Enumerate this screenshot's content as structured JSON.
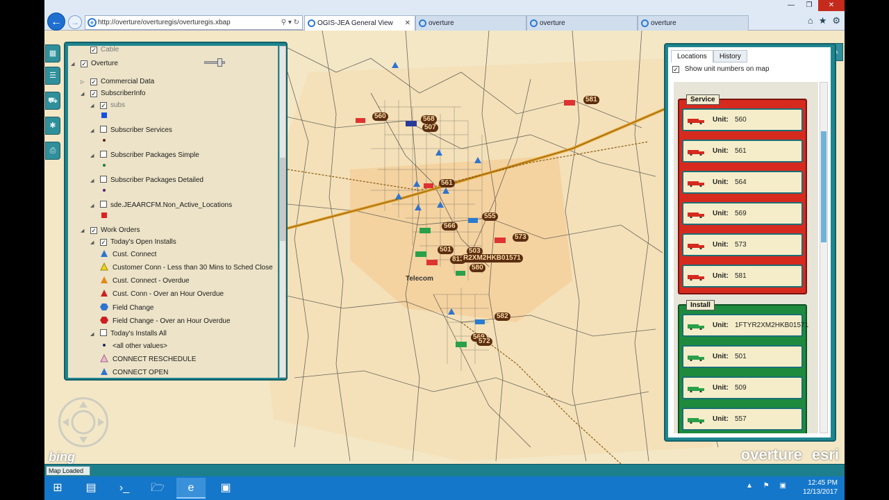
{
  "browser": {
    "address": "http://overture/overturegis/overturegis.xbap",
    "tabs": [
      {
        "label": "OGIS-JEA General View",
        "active": true
      },
      {
        "label": "overture",
        "active": false
      },
      {
        "label": "overture",
        "active": false
      },
      {
        "label": "overture",
        "active": false
      }
    ]
  },
  "layers": {
    "rows": [
      {
        "text": "Cable",
        "level": 1,
        "check": "checked",
        "expand": "",
        "muted": true
      },
      {
        "text": "Overture",
        "level": 0,
        "check": "checked",
        "expand": "open"
      },
      {
        "text": "Commercial Data",
        "level": 1,
        "check": "checked",
        "expand": "closed"
      },
      {
        "text": "SubscriberInfo",
        "level": 1,
        "check": "checked",
        "expand": "open"
      },
      {
        "text": "subs",
        "level": 2,
        "check": "checked",
        "expand": "open",
        "muted": true
      },
      {
        "text": "",
        "level": 3,
        "symbol": "square-blue"
      },
      {
        "text": "Subscriber Services",
        "level": 2,
        "check": "unchecked",
        "expand": "open"
      },
      {
        "text": "",
        "level": 3,
        "symbol": "dot-brown"
      },
      {
        "text": "Subscriber Packages Simple",
        "level": 2,
        "check": "unchecked",
        "expand": "open"
      },
      {
        "text": "",
        "level": 3,
        "symbol": "dot-green"
      },
      {
        "text": "Subscriber Packages Detailed",
        "level": 2,
        "check": "unchecked",
        "expand": "open"
      },
      {
        "text": "",
        "level": 3,
        "symbol": "dot-purple"
      },
      {
        "text": "sde.JEAARCFM.Non_Active_Locations",
        "level": 2,
        "check": "unchecked",
        "expand": "open"
      },
      {
        "text": "",
        "level": 3,
        "symbol": "square-red"
      },
      {
        "text": "Work Orders",
        "level": 1,
        "check": "checked",
        "expand": "open"
      },
      {
        "text": "Today's Open Installs",
        "level": 2,
        "check": "checked",
        "expand": "open"
      },
      {
        "text": "Cust. Connect",
        "level": 3,
        "symbol": "triangle-blue"
      },
      {
        "text": "Customer Conn - Less than 30 Mins to Sched Close",
        "level": 3,
        "symbol": "triangle-yellow"
      },
      {
        "text": "Cust. Connect - Overdue",
        "level": 3,
        "symbol": "triangle-orange"
      },
      {
        "text": "Cust. Conn - Over an Hour Overdue",
        "level": 3,
        "symbol": "triangle-red"
      },
      {
        "text": "Field Change",
        "level": 3,
        "symbol": "hexagon-blue"
      },
      {
        "text": "Field Change - Over an Hour Overdue",
        "level": 3,
        "symbol": "hexagon-red"
      },
      {
        "text": "Today's Installs All",
        "level": 2,
        "check": "unchecked",
        "expand": "open"
      },
      {
        "text": "<all other values>",
        "level": 3,
        "symbol": "dot-navy"
      },
      {
        "text": "CONNECT RESCHEDULE",
        "level": 3,
        "symbol": "triangle-pink"
      },
      {
        "text": "CONNECT OPEN",
        "level": 3,
        "symbol": "triangle-blue"
      }
    ]
  },
  "units_panel": {
    "tabs": [
      "Locations",
      "History"
    ],
    "show_numbers_label": "Show unit numbers on map",
    "unit_label": "Unit:",
    "service": {
      "title": "Service",
      "units": [
        "560",
        "561",
        "564",
        "569",
        "573",
        "581"
      ]
    },
    "install": {
      "title": "Install",
      "units": [
        "1FTYR2XM2HKB01571",
        "501",
        "509",
        "557"
      ]
    }
  },
  "map": {
    "place_label": "Telecom",
    "markers": [
      "581",
      "560",
      "568",
      "507",
      "561",
      "555",
      "566",
      "573",
      "501",
      "503",
      "813",
      "R2XM2HKB01571",
      "580",
      "582",
      "569",
      "572"
    ]
  },
  "status": "Map Loaded",
  "logos": {
    "bing": "bing",
    "overture": "overture",
    "esri": "esri"
  },
  "clock": {
    "time": "12:45 PM",
    "date": "12/13/2017"
  },
  "colors": {
    "service": "#d62a1f",
    "install": "#1e8a3e",
    "panel": "#1e858f"
  }
}
